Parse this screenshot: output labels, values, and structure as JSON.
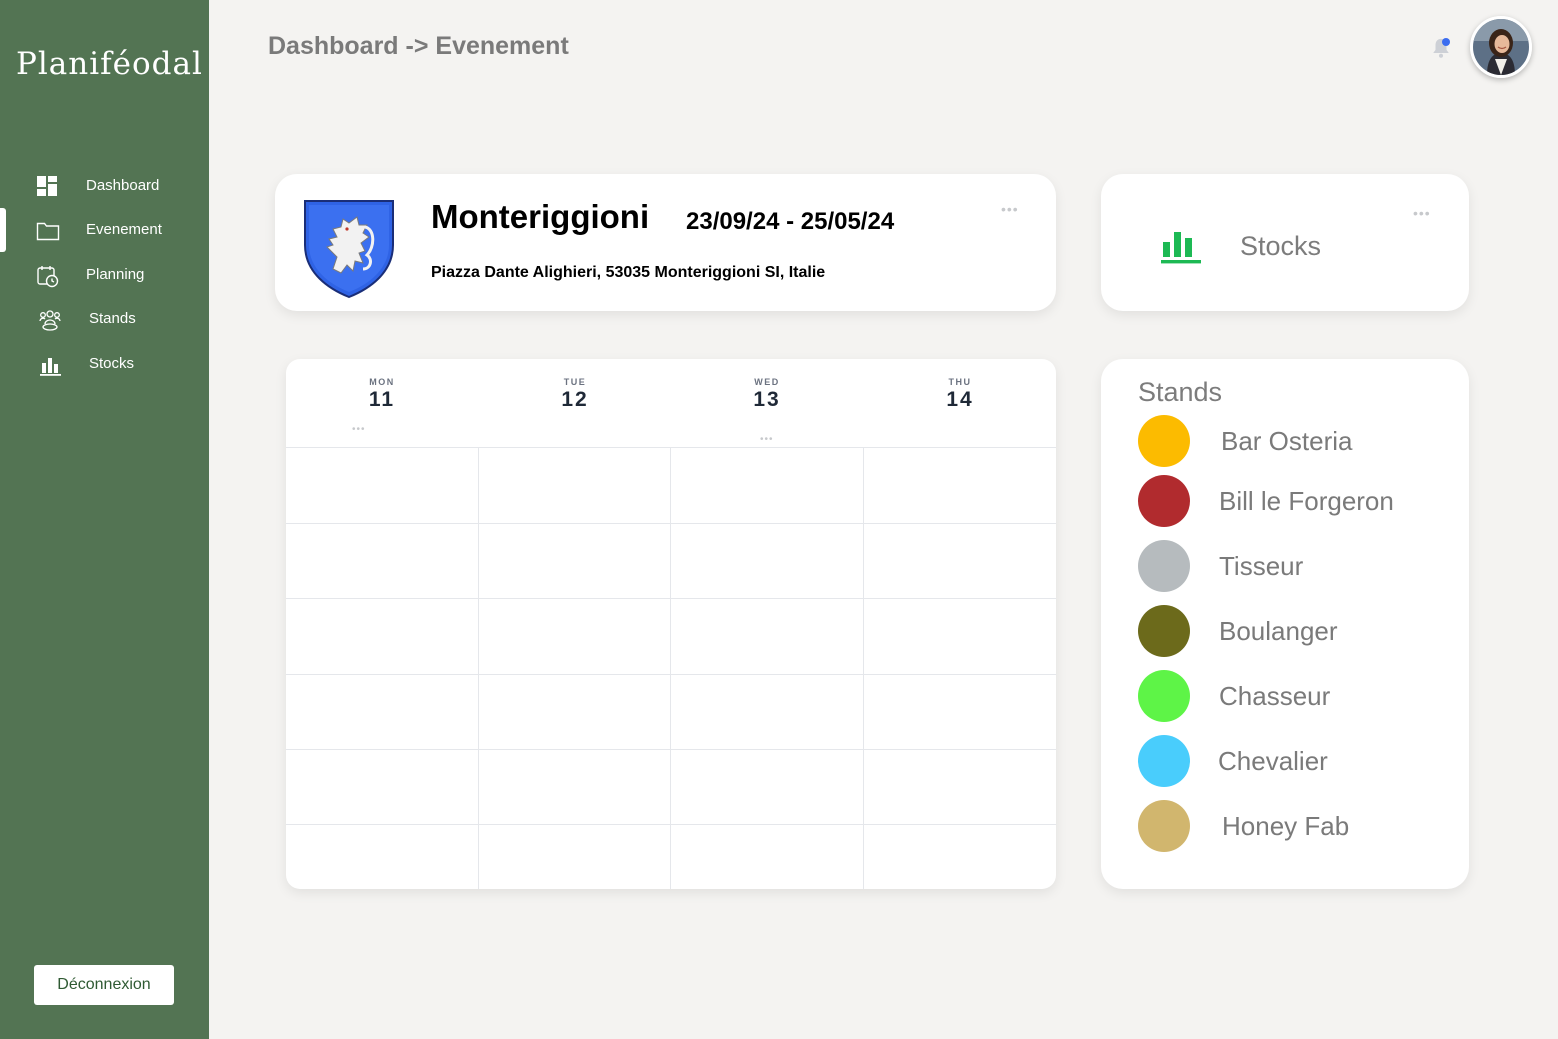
{
  "app": {
    "brand": "Planiféodal"
  },
  "sidebar": {
    "items": [
      {
        "label": "Dashboard",
        "icon": "dashboard-icon"
      },
      {
        "label": "Evenement",
        "icon": "folder-icon"
      },
      {
        "label": "Planning",
        "icon": "calendar-clock-icon"
      },
      {
        "label": "Stands",
        "icon": "people-group-icon"
      },
      {
        "label": "Stocks",
        "icon": "bar-chart-icon"
      }
    ],
    "active": "Evenement",
    "logout_label": "Déconnexion"
  },
  "header": {
    "breadcrumb": "Dashboard -> Evenement",
    "notification_icon": "bell-icon",
    "avatar_icon": "user-avatar"
  },
  "event": {
    "name": "Monteriggioni",
    "dates": "23/09/24 - 25/05/24",
    "address": "Piazza Dante Alighieri, 53035 Monteriggioni SI, Italie",
    "menu_icon": "more-horizontal-icon",
    "crest_icon": "lion-crest-icon"
  },
  "stocks_card": {
    "label": "Stocks",
    "icon": "bar-chart-icon",
    "accent": "#1db954"
  },
  "calendar": {
    "days": [
      {
        "name": "MON",
        "num": "11"
      },
      {
        "name": "TUE",
        "num": "12"
      },
      {
        "name": "WED",
        "num": "13"
      },
      {
        "name": "THU",
        "num": "14"
      }
    ],
    "rows": 6
  },
  "stands": {
    "title": "Stands",
    "items": [
      {
        "label": "Bar Osteria",
        "color": "#fcbb00"
      },
      {
        "label": "Bill le Forgeron",
        "color": "#b12b2e"
      },
      {
        "label": "Tisseur",
        "color": "#b6bbbe"
      },
      {
        "label": "Boulanger",
        "color": "#6c6a1b"
      },
      {
        "label": "Chasseur",
        "color": "#5ef447"
      },
      {
        "label": "Chevalier",
        "color": "#49cdfc"
      },
      {
        "label": "Honey Fab",
        "color": "#d1b66e"
      }
    ]
  },
  "colors": {
    "sidebar": "#537453",
    "background": "#f4f3f1"
  }
}
